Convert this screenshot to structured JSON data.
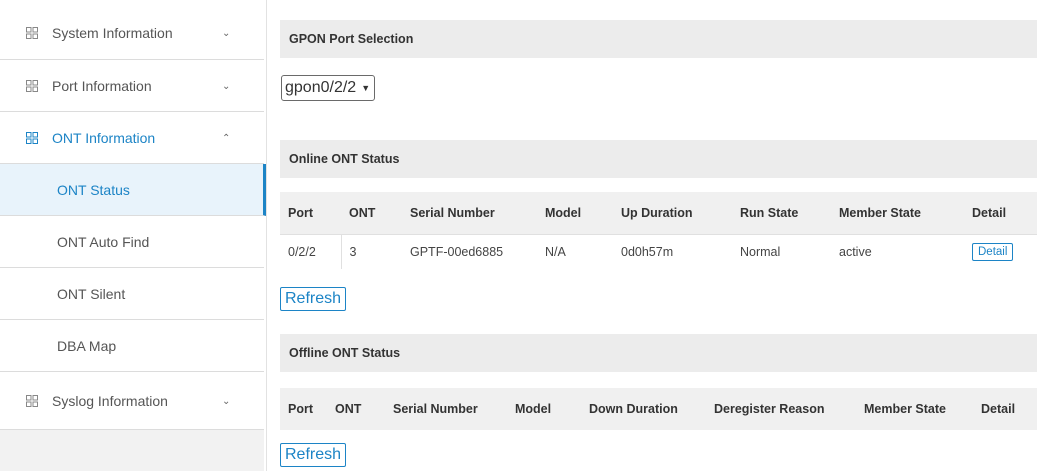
{
  "sidebar": {
    "menu": [
      {
        "label": "System Information",
        "chevron": "chevron-down-icon"
      },
      {
        "label": "Port Information",
        "chevron": "chevron-down-icon"
      },
      {
        "label": "ONT Information",
        "chevron": "chevron-up-icon"
      },
      {
        "label": "Syslog Information",
        "chevron": "chevron-down-icon"
      }
    ],
    "submenu": [
      {
        "label": "ONT Status"
      },
      {
        "label": "ONT Auto Find"
      },
      {
        "label": "ONT Silent"
      },
      {
        "label": "DBA Map"
      }
    ],
    "accent_color": "#1c84c6"
  },
  "gpon": {
    "header": "GPON Port Selection",
    "selected_port": "gpon0/2/2"
  },
  "online": {
    "header": "Online ONT Status",
    "columns": [
      "Port",
      "ONT",
      "Serial Number",
      "Model",
      "Up Duration",
      "Run State",
      "Member State",
      "Detail"
    ],
    "rows": [
      {
        "port": "0/2/2",
        "ont": "3",
        "serial": "GPTF-00ed6885",
        "model": "N/A",
        "up_duration": "0d0h57m",
        "run_state": "Normal",
        "member_state": "active",
        "detail": "Detail"
      }
    ],
    "refresh_label": "Refresh"
  },
  "offline": {
    "header": "Offline ONT Status",
    "columns": [
      "Port",
      "ONT",
      "Serial Number",
      "Model",
      "Down Duration",
      "Deregister Reason",
      "Member State",
      "Detail"
    ],
    "refresh_label": "Refresh"
  }
}
